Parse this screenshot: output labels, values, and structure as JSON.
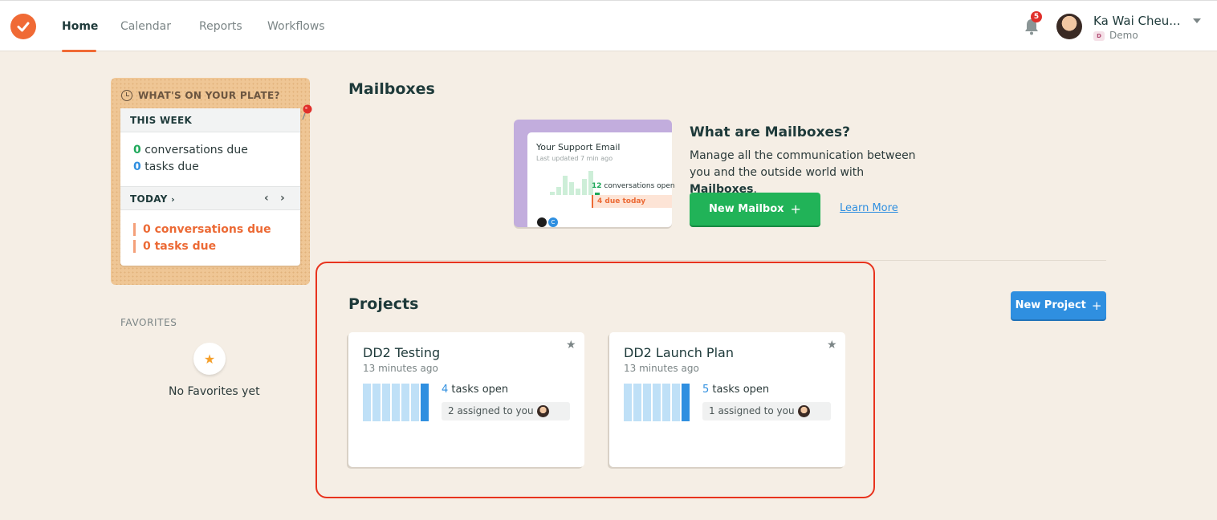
{
  "nav": {
    "items": [
      {
        "label": "Home",
        "active": true
      },
      {
        "label": "Calendar",
        "active": false
      },
      {
        "label": "Reports",
        "active": false
      },
      {
        "label": "Workflows",
        "active": false
      }
    ],
    "notifications_count": "5",
    "user_name": "Ka Wai Cheu...",
    "org_badge": "D",
    "org_name": "Demo"
  },
  "plate": {
    "title": "WHAT'S ON YOUR PLATE?",
    "this_week": {
      "label": "THIS WEEK",
      "conversations_count": "0",
      "conversations_text": "conversations due",
      "tasks_count": "0",
      "tasks_text": "tasks due"
    },
    "today": {
      "label": "TODAY",
      "conversations_due": "0 conversations due",
      "tasks_due": "0 tasks due"
    }
  },
  "favorites": {
    "title": "FAVORITES",
    "empty_text": "No Favorites yet"
  },
  "mailboxes": {
    "heading": "Mailboxes",
    "illustration": {
      "title": "Your Support Email",
      "subtitle": "Last updated 7 min ago",
      "open_count": "12",
      "open_text": "conversations open",
      "due_text": "4 due today",
      "avatar_letter": "C"
    },
    "promo_title": "What are Mailboxes?",
    "promo_desc_prefix": "Manage all the communication between you and the outside world with ",
    "promo_desc_bold": "Mailboxes",
    "promo_desc_suffix": ".",
    "new_button": "New Mailbox",
    "learn_more": "Learn More"
  },
  "projects": {
    "heading": "Projects",
    "new_button": "New Project",
    "cards": [
      {
        "name": "DD2 Testing",
        "time": "13 minutes ago",
        "open_count": "4",
        "open_text": "tasks open",
        "assigned": "2 assigned to you"
      },
      {
        "name": "DD2 Launch Plan",
        "time": "13 minutes ago",
        "open_count": "5",
        "open_text": "tasks open",
        "assigned": "1 assigned to you"
      }
    ]
  },
  "colors": {
    "brand_orange": "#f06a35",
    "green": "#21b358",
    "blue": "#2f8fe0",
    "highlight_red": "#e8331e"
  }
}
